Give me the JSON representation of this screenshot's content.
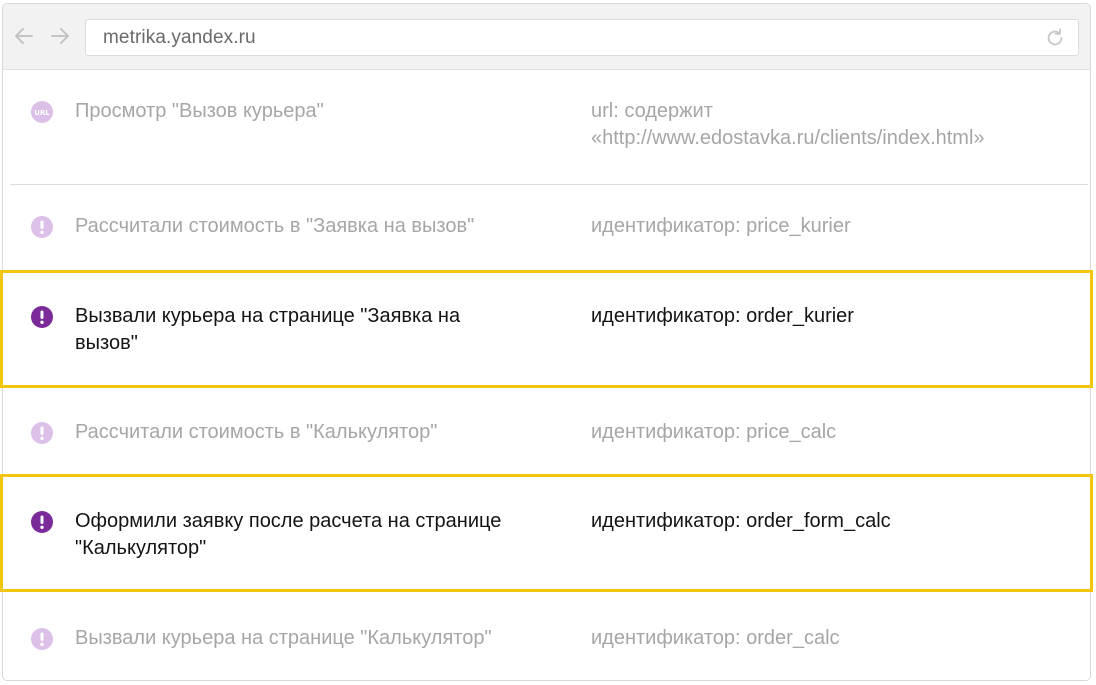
{
  "browser": {
    "url": "metrika.yandex.ru",
    "url_icon_label": "URL"
  },
  "colors": {
    "accent_purple": "#7b2a9a",
    "dim_purple": "#dcc0e8",
    "highlight_border": "#f2c511",
    "dim_text": "#a6a6a6",
    "active_text": "#141414"
  },
  "goals": [
    {
      "icon": "url-icon",
      "name": "Просмотр \"Вызов курьера\"",
      "condition_line1": "url: содержит",
      "condition_line2": "«http://www.edostavka.ru/clients/index.html»",
      "highlighted": false
    },
    {
      "icon": "exclamation-icon",
      "name": "Рассчитали стоимость в \"Заявка на вызов\"",
      "condition": "идентификатор: price_kurier",
      "highlighted": false
    },
    {
      "icon": "exclamation-icon",
      "name_line1": "Вызвали курьера на странице \"Заявка на",
      "name_line2": "вызов\"",
      "condition": "идентификатор: order_kurier",
      "highlighted": true
    },
    {
      "icon": "exclamation-icon",
      "name": "Рассчитали стоимость в \"Калькулятор\"",
      "condition": "идентификатор: price_calc",
      "highlighted": false
    },
    {
      "icon": "exclamation-icon",
      "name_line1": "Оформили заявку после расчета на странице",
      "name_line2": "\"Калькулятор\"",
      "condition": "идентификатор: order_form_calc",
      "highlighted": true
    },
    {
      "icon": "exclamation-icon",
      "name": "Вызвали курьера на странице \"Калькулятор\"",
      "condition": "идентификатор: order_calc",
      "highlighted": false
    }
  ]
}
